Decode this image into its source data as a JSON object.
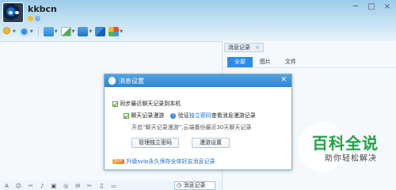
{
  "header": {
    "username": "kkbcn",
    "window_controls": [
      "─",
      "□",
      "×"
    ]
  },
  "toolbar": {
    "items": [
      {
        "icon": "microphone-icon",
        "color": "#e0a22b"
      },
      {
        "icon": "camera-icon",
        "color": "#2f8fe0"
      },
      {
        "icon": "folder-icon",
        "color": "#3f9be6"
      },
      {
        "icon": "add-file-icon",
        "color": "#50b14d"
      },
      {
        "icon": "screen-share-icon",
        "color": "#2a7ad0"
      },
      {
        "icon": "remote-icon",
        "color": "#2a6cc8"
      },
      {
        "icon": "apps-icon",
        "color": "#e04f3c"
      }
    ]
  },
  "right_panel": {
    "tab_label": "消息记录",
    "subtabs": [
      "全部",
      "图片",
      "文件"
    ],
    "record_button": "消息记录"
  },
  "dialog": {
    "title": "消息设置",
    "sync_label": "同步最近聊天记录到本机",
    "roaming_label": "聊天记录漫游",
    "verify_prefix": "验证",
    "verify_link": "独立密码",
    "verify_suffix": "查看消息漫游记录",
    "roaming_desc": "开启“聊天记录漫游”,云端备份最近30天聊天记录",
    "manage_button": "管理独立密码",
    "roaming_settings_button": "漫游设置",
    "svip_badge": "SVIP",
    "svip_link": "升级svip永久保存全体好友消息记录"
  },
  "watermark": {
    "title": "百科全说",
    "subtitle": "助你轻松解决"
  },
  "bottom_tools": [
    "A",
    "☺",
    "✂",
    "♪",
    "▣",
    "◎",
    "✉",
    "✂",
    "♫",
    "▭"
  ]
}
